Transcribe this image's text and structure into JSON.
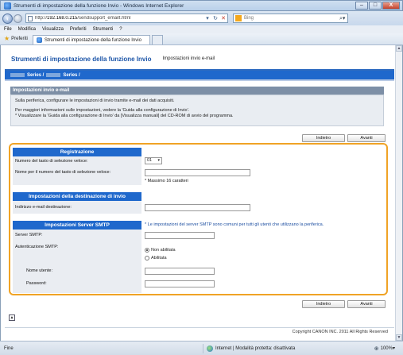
{
  "window": {
    "title": "Strumenti di impostazione della funzione Invio - Windows Internet Explorer",
    "minimize": "–",
    "maximize": "□",
    "close": "X"
  },
  "address": {
    "url_host": "192.168.0.215",
    "url_prefix": "http://",
    "url_path": "/sendsupport_emailt.html",
    "search_placeholder": "Bing"
  },
  "menu": [
    "File",
    "Modifica",
    "Visualizza",
    "Preferiti",
    "Strumenti",
    "?"
  ],
  "favorites": {
    "label": "Preferiti",
    "tab_title": "Strumenti di impostazione della funzione Invio"
  },
  "page": {
    "app_title": "Strumenti di impostazione della funzione Invio",
    "app_subtitle": "Impostazioni invio e-mail",
    "series_label": "Series /",
    "series_label2": "Series /",
    "section_title": "Impostazioni invio e-mail",
    "info_line1": "Sulla periferica, configurare le impostazioni di invio tramite e-mail dei dati acquisiti.",
    "info_line2": "Per maggiori informazioni sulle impostazioni, vedere la 'Guida alla configurazione di Invio'.",
    "info_line3": "* Visualizzare la 'Guida alla configurazione di Invio' da [Visualizza manuali] del CD-ROM di avvio del programma.",
    "back_label": "Indietro",
    "next_label": "Avanti"
  },
  "form": {
    "registration": {
      "header": "Registrazione",
      "speed_dial_label": "Numero del tasto di selezione veloce:",
      "speed_dial_value": "01",
      "name_label": "Nome per il numero del tasto di selezione veloce:",
      "name_value": "",
      "max_note": "* Massimo 16 caratteri"
    },
    "destination": {
      "header": "Impostazioni della destinazione di invio",
      "email_label": "Indirizzo e-mail destinazione:",
      "email_value": ""
    },
    "smtp": {
      "header": "Impostazioni Server SMTP",
      "note": "* Le impostazioni del server SMTP sono comuni per tutti gli utenti che utilizzano la periferica.",
      "server_label": "Server SMTP:",
      "server_value": "",
      "auth_label": "Autenticazione SMTP:",
      "auth_options": [
        "Non abilitata",
        "Abilitata"
      ],
      "auth_selected": "Non abilitata",
      "user_label": "Nome utente:",
      "user_value": "",
      "password_label": "Password:",
      "password_value": ""
    }
  },
  "footer": {
    "copyright": "Copyright CANON INC. 2011 All Rights Reserved"
  },
  "status": {
    "text": "Fine",
    "zone": "Internet | Modalità protetta: disattivata",
    "zoom": "100%"
  }
}
